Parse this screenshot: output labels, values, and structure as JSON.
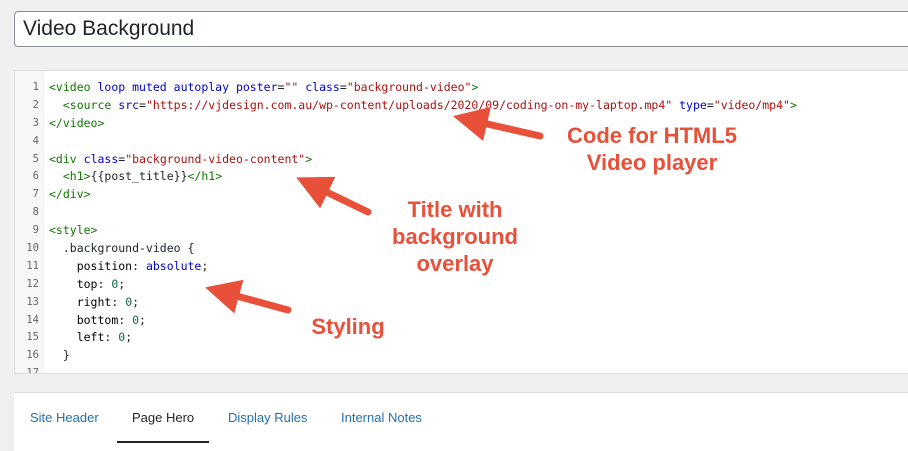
{
  "title_field": {
    "value": "Video Background"
  },
  "code_editor": {
    "lines": [
      {
        "num": "1",
        "html": "<span class=\"tg\">&lt;video</span> <span class=\"at\">loop muted autoplay poster</span>=<span class=\"st\">\"\"</span> <span class=\"at\">class</span>=<span class=\"st\">\"background-video\"</span><span class=\"tg\">&gt;</span>"
      },
      {
        "num": "2",
        "html": "  <span class=\"tg\">&lt;source</span> <span class=\"at\">src</span>=<span class=\"st\">\"https://vjdesign.com.au/wp-content/uploads/2020/09/coding-on-my-laptop.mp4\"</span> <span class=\"at\">type</span>=<span class=\"st\">\"video/mp4\"</span><span class=\"tg\">&gt;</span>"
      },
      {
        "num": "3",
        "html": "<span class=\"tg\">&lt;/video&gt;</span>"
      },
      {
        "num": "4",
        "html": ""
      },
      {
        "num": "5",
        "html": "<span class=\"tg\">&lt;div</span> <span class=\"at\">class</span>=<span class=\"st\">\"background-video-content\"</span><span class=\"tg\">&gt;</span>"
      },
      {
        "num": "6",
        "html": "  <span class=\"tg\">&lt;h1&gt;</span>{{post_title}}<span class=\"tg\">&lt;/h1&gt;</span>"
      },
      {
        "num": "7",
        "html": "<span class=\"tg\">&lt;/div&gt;</span>"
      },
      {
        "num": "8",
        "html": ""
      },
      {
        "num": "9",
        "html": "<span class=\"tg\">&lt;style&gt;</span>"
      },
      {
        "num": "10",
        "html": "  .background-video {"
      },
      {
        "num": "11",
        "html": "    <span class=\"pr\">position</span>: <span class=\"at\">absolute</span>;"
      },
      {
        "num": "12",
        "html": "    <span class=\"pr\">top</span>: <span class=\"nu\">0</span>;"
      },
      {
        "num": "13",
        "html": "    <span class=\"pr\">right</span>: <span class=\"nu\">0</span>;"
      },
      {
        "num": "14",
        "html": "    <span class=\"pr\">bottom</span>: <span class=\"nu\">0</span>;"
      },
      {
        "num": "15",
        "html": "    <span class=\"pr\">left</span>: <span class=\"nu\">0</span>;"
      },
      {
        "num": "16",
        "html": "  }"
      },
      {
        "num": "17",
        "html": ""
      }
    ]
  },
  "annotations": {
    "code_player": "Code for HTML5\nVideo player",
    "title_overlay": "Title with\nbackground\noverlay",
    "styling": "Styling"
  },
  "colors": {
    "annotation": "#e8503a",
    "link": "#2271b1",
    "active_tab": "#1d2327"
  },
  "tabs": [
    {
      "label": "Site Header"
    },
    {
      "label": "Page Hero"
    },
    {
      "label": "Display Rules"
    },
    {
      "label": "Internal Notes"
    }
  ],
  "active_tab": "Page Hero"
}
